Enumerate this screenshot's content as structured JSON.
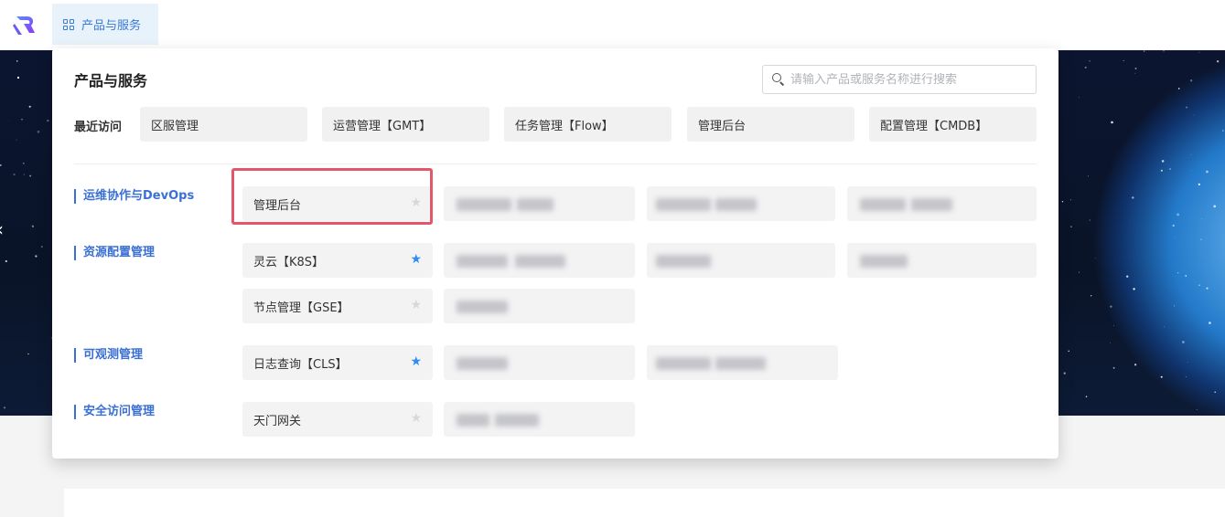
{
  "topbar": {
    "nav_label": "产品与服务",
    "nav_icon": "grid-icon"
  },
  "panel": {
    "title": "产品与服务",
    "search_placeholder": "请输入产品或服务名称进行搜索",
    "recent_label": "最近访问",
    "recent_items": [
      "区服管理",
      "运营管理【GMT】",
      "任务管理【Flow】",
      "管理后台",
      "配置管理【CMDB】"
    ],
    "categories": [
      {
        "label": "运维协作与DevOps"
      },
      {
        "label": "资源配置管理"
      },
      {
        "label": "可观测管理"
      },
      {
        "label": "安全访问管理"
      }
    ],
    "products": [
      {
        "label": "管理后台",
        "starred": false
      },
      {
        "label": "灵云【K8S】",
        "starred": true
      },
      {
        "label": "节点管理【GSE】",
        "starred": false
      },
      {
        "label": "日志查询【CLS】",
        "starred": true
      },
      {
        "label": "天门网关",
        "starred": false
      }
    ]
  },
  "colors": {
    "accent": "#3a6fd4",
    "star_active": "#2f8cf0",
    "highlight": "#e4566a"
  }
}
